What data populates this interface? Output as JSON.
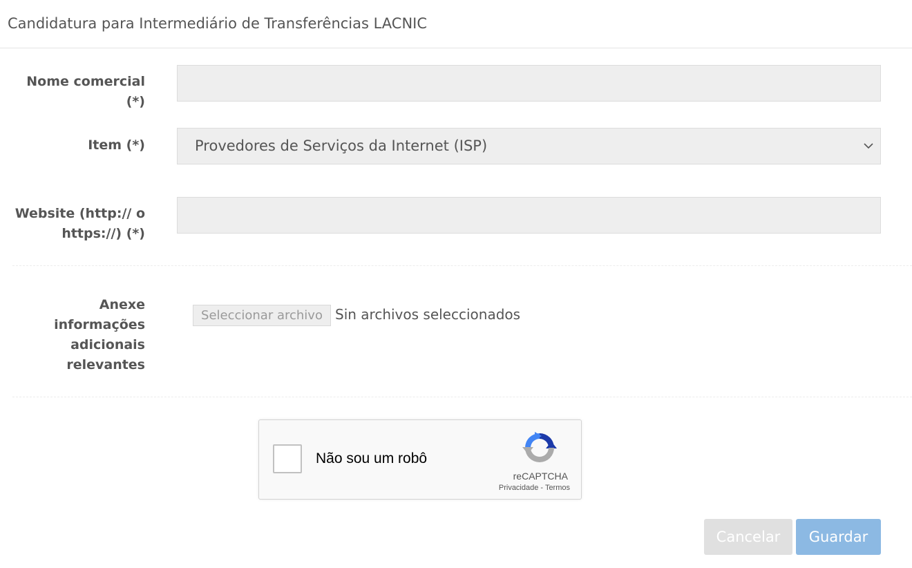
{
  "header": {
    "title": "Candidatura para Intermediário de Transferências LACNIC"
  },
  "form": {
    "nome_comercial": {
      "label": "Nome comercial (*)",
      "value": ""
    },
    "item": {
      "label": "Item (*)",
      "selected": "Provedores de Serviços da Internet (ISP)"
    },
    "website": {
      "label": "Website (http:// o https://) (*)",
      "value": ""
    },
    "anexe": {
      "label": "Anexe informações adicionais relevantes",
      "button_label": "Seleccionar archivo",
      "status": "Sin archivos seleccionados"
    }
  },
  "recaptcha": {
    "label": "Não sou um robô",
    "brand": "reCAPTCHA",
    "privacy": "Privacidade",
    "separator": " - ",
    "terms": "Termos"
  },
  "actions": {
    "cancel_label": "Cancelar",
    "save_label": "Guardar"
  },
  "colors": {
    "field_background": "#eeeeee",
    "cancel_button": "#e0e0e0",
    "save_button": "#8cb9e3",
    "recaptcha_blue": "#1c3aa9",
    "recaptcha_light_blue": "#4285f4",
    "recaptcha_gray": "#ababab"
  },
  "icons": {
    "select_arrow": "chevron-down-icon",
    "recaptcha_logo": "recaptcha-logo-icon"
  }
}
